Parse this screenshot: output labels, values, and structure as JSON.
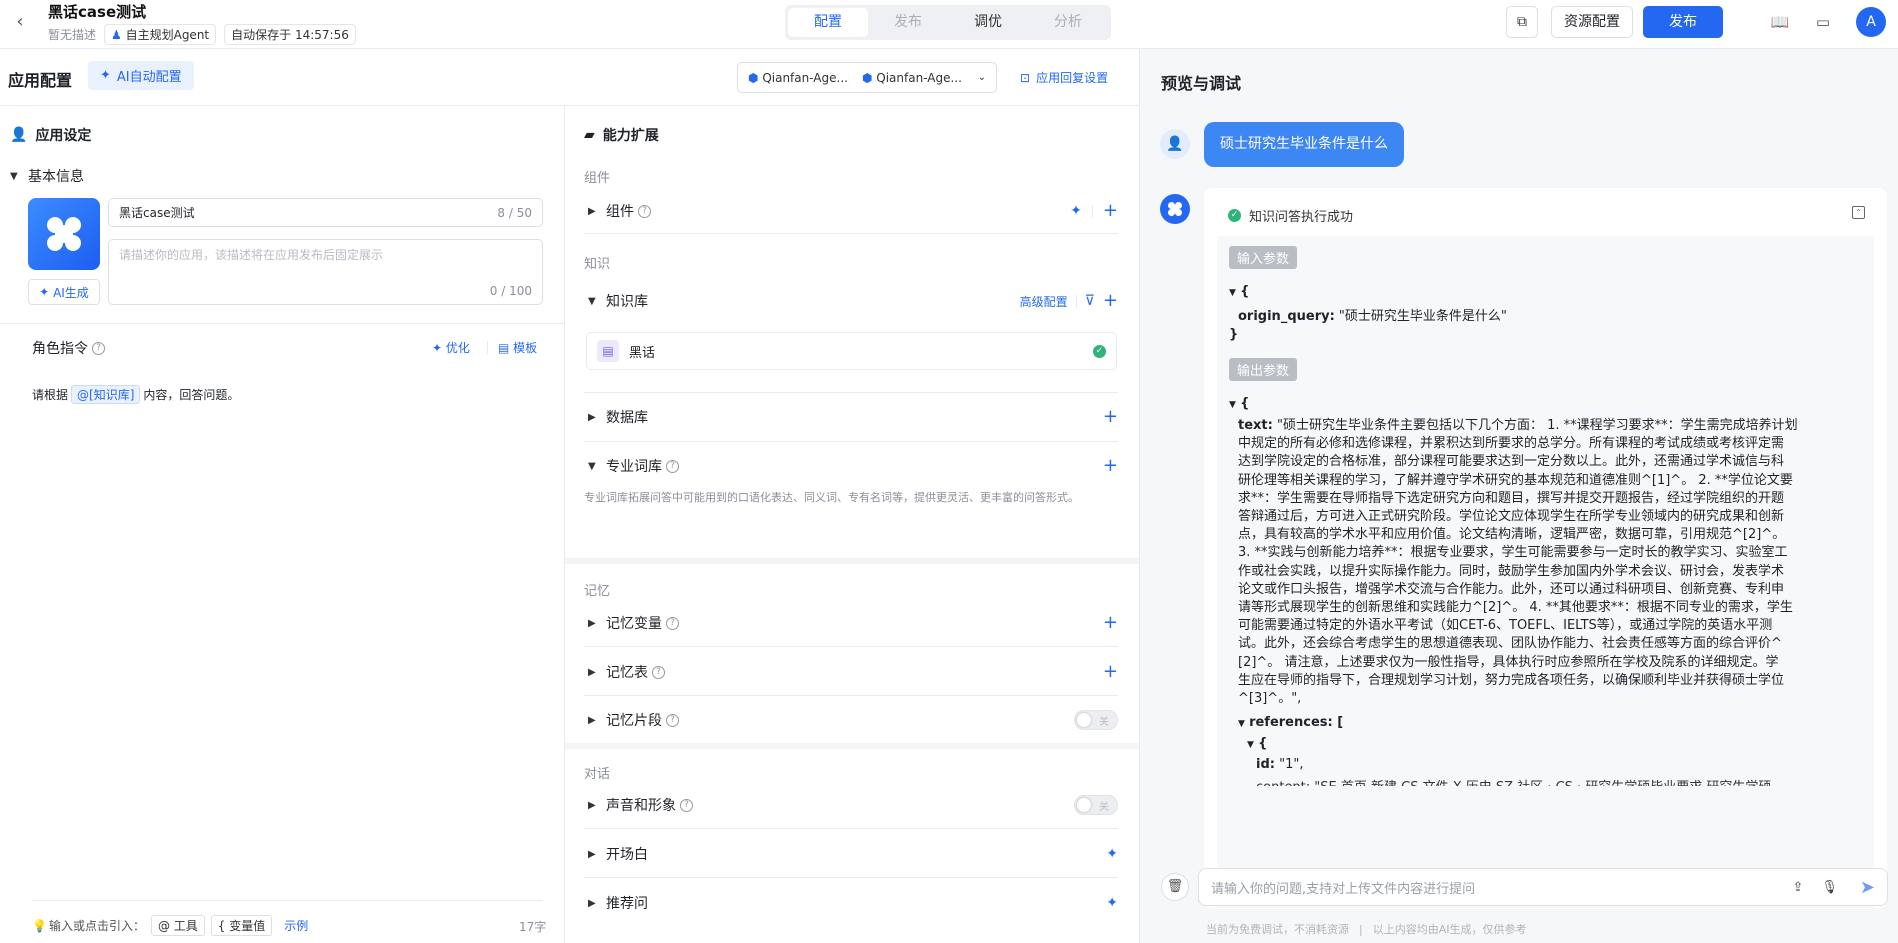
{
  "header": {
    "back_icon": "chevron-left-icon",
    "app_name": "黑话case测试",
    "desc": "暂无描述",
    "agent_tag": "自主规划Agent",
    "autosave": "自动保存于 14:57:56",
    "tabs": [
      "配置",
      "发布",
      "调优",
      "分析"
    ],
    "active_tab": "配置",
    "resource_btn": "资源配置",
    "publish_btn": "发布",
    "avatar": "A"
  },
  "config": {
    "title": "应用配置",
    "ai_config": "AI自动配置",
    "model1": "Qianfan-Age...",
    "model2": "Qianfan-Age...",
    "reply_settings": "应用回复设置"
  },
  "settings": {
    "title": "应用设定",
    "basic_info": "基本信息",
    "name_value": "黑话case测试",
    "name_count": "8 / 50",
    "desc_placeholder": "请描述你的应用，该描述将在应用发布后固定展示",
    "desc_count": "0 / 100",
    "ai_gen": "AI生成",
    "role_title": "角色指令",
    "optimize": "优化",
    "template": "模板",
    "prompt_pre": "请根据",
    "prompt_tag": "@[知识库]",
    "prompt_post": "内容，回答问题。",
    "footer_hint": "输入或点击引入：",
    "footer_tool": "@ 工具",
    "footer_var": "{ 变量值",
    "footer_example": "示例",
    "footer_count": "17字"
  },
  "capabilities": {
    "title": "能力扩展",
    "group_component": "组件",
    "component": "组件",
    "group_knowledge": "知识",
    "kb": "知识库",
    "kb_advanced": "高级配置",
    "kb_item": "黑话",
    "database": "数据库",
    "lexicon": "专业词库",
    "lexicon_desc": "专业词库拓展问答中可能用到的口语化表达、同义词、专有名词等，提供更灵活、更丰富的问答形式。",
    "group_memory": "记忆",
    "mem_var": "记忆变量",
    "mem_table": "记忆表",
    "mem_snippet": "记忆片段",
    "toggle_off": "关",
    "group_dialog": "对话",
    "voice": "声音和形象",
    "opening": "开场白",
    "suggest": "推荐问"
  },
  "preview": {
    "title": "预览与调试",
    "user_msg": "硕士研究生毕业条件是什么",
    "status": "知识问答执行成功",
    "input_label": "输入参数",
    "output_label": "输出参数",
    "origin_query_key": "origin_query:",
    "origin_query_val": "\"硕士研究生毕业条件是什么\"",
    "text_key": "text:",
    "text_lines": [
      "\"硕士研究生毕业条件主要包括以下几个方面： 1. **课程学习要求**：学生需完成培养计划",
      "中规定的所有必修和选修课程，并累积达到所要求的总学分。所有课程的考试成绩或考核评定需",
      "达到学院设定的合格标准，部分课程可能要求达到一定分数以上。此外，还需通过学术诚信与科",
      "研伦理等相关课程的学习，了解并遵守学术研究的基本规范和道德准则^[1]^。 2. **学位论文要",
      "求**：学生需要在导师指导下选定研究方向和题目，撰写并提交开题报告，经过学院组织的开题",
      "答辩通过后，方可进入正式研究阶段。学位论文应体现学生在所学专业领域内的研究成果和创新",
      "点，具有较高的学术水平和应用价值。论文结构清晰，逻辑严密，数据可靠，引用规范^[2]^。",
      "3. **实践与创新能力培养**：根据专业要求，学生可能需要参与一定时长的教学实习、实验室工",
      "作或社会实践，以提升实际操作能力。同时，鼓励学生参加国内外学术会议、研讨会，发表学术",
      "论文或作口头报告，增强学术交流与合作能力。此外，还可以通过科研项目、创新竞赛、专利申",
      "请等形式展现学生的创新思维和实践能力^[2]^。 4. **其他要求**：根据不同专业的需求，学生",
      "可能需要通过特定的外语水平考试（如CET-6、TOEFL、IELTS等），或通过学院的英语水平测",
      "试。此外，还会综合考虑学生的思想道德表现、团队协作能力、社会责任感等方面的综合评价^",
      "[2]^。 请注意，上述要求仅为一般性指导，具体执行时应参照所在学校及院系的详细规定。学",
      "生应在导师的指导下，合理规划学习计划，努力完成各项任务，以确保顺利毕业并获得硕士学位",
      "^[3]^。\","
    ],
    "references_key": "references: [",
    "id_key": "id:",
    "id_val": "\"1\",",
    "content_partial": "content: \"SE 首页 新建 CS 文件 X 历史 SZ 社区 · CS · 研究生学硕毕业要求 研究生学硕",
    "input_placeholder": "请输入你的问题,支持对上传文件内容进行提问",
    "disclaimer1": "当前为免费调试，不消耗资源",
    "disclaimer2": "以上内容均由AI生成，仅供参考"
  }
}
